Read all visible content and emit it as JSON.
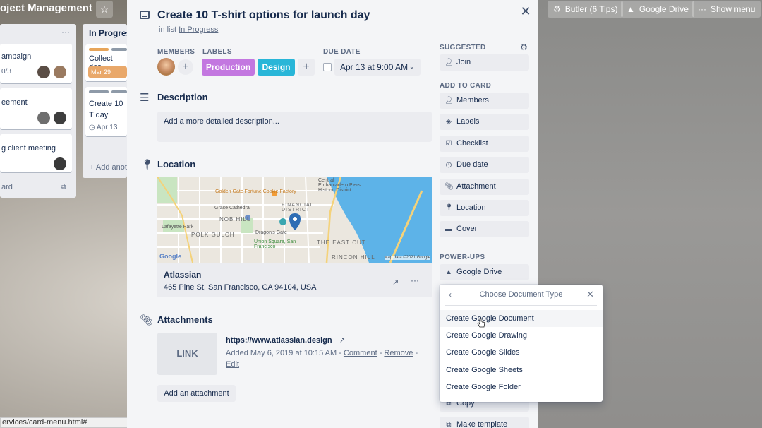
{
  "board": {
    "title": "oject Management",
    "header_buttons": {
      "butler": "Butler (6 Tips)",
      "drive": "Google Drive",
      "menu": "Show menu"
    },
    "lists": [
      {
        "title": "",
        "cards": [
          "ampaign",
          "eement",
          "g client meeting"
        ],
        "badge": "0/3",
        "footer": "ard"
      },
      {
        "title": "In Progress",
        "cards": [
          "Collect des",
          "Create 10 T day"
        ],
        "date": "Apr 13",
        "add": "+ Add anot",
        "mar": "Mar 29"
      }
    ]
  },
  "status_bar": {
    "url": "ervices/card-menu.html#"
  },
  "card": {
    "title": "Create 10 T-shirt options for launch day",
    "in_list_prefix": "in list ",
    "in_list_name": "In Progress",
    "members_label": "MEMBERS",
    "labels_label": "LABELS",
    "due_label": "DUE DATE",
    "labels": [
      {
        "name": "Production",
        "color": "#c377e0"
      },
      {
        "name": "Design",
        "color": "#29b6d8"
      }
    ],
    "due_value": "Apr 13 at 9:00 AM",
    "description": {
      "title": "Description",
      "placeholder": "Add a more detailed description..."
    },
    "location": {
      "title": "Location",
      "name": "Atlassian",
      "address": "465 Pine St, San Francisco, CA 94104, USA",
      "map_labels": [
        "Golden Gate Fortune Cookie Factory",
        "Grace Cathedral",
        "NOB HILL",
        "POLK GULCH",
        "Lafayette Park",
        "Dragon's Gate",
        "Union Square, San Francisco",
        "FINANCIAL DISTRICT",
        "Central Embarcadero Piers Historic District",
        "THE EAST CUT",
        "RINCON HILL"
      ],
      "map_credit": "Map data ©2021 Google",
      "map_brand": "Google"
    },
    "attachments": {
      "title": "Attachments",
      "thumb": "LINK",
      "url": "https://www.atlassian.design",
      "added": "Added May 6, 2019 at 10:15 AM - ",
      "comment": "Comment",
      "remove": "Remove",
      "edit": "Edit",
      "add_button": "Add an attachment"
    }
  },
  "sidebar": {
    "suggested_label": "SUGGESTED",
    "join": "Join",
    "add_to_card_label": "ADD TO CARD",
    "add_items": [
      "Members",
      "Labels",
      "Checklist",
      "Due date",
      "Attachment",
      "Location",
      "Cover"
    ],
    "powerups_label": "POWER-UPS",
    "google_drive": "Google Drive",
    "copy": "Copy",
    "make_template": "Make template"
  },
  "popover": {
    "title": "Choose Document Type",
    "items": [
      "Create Google Document",
      "Create Google Drawing",
      "Create Google Slides",
      "Create Google Sheets",
      "Create Google Folder"
    ],
    "hovered_index": 0
  }
}
